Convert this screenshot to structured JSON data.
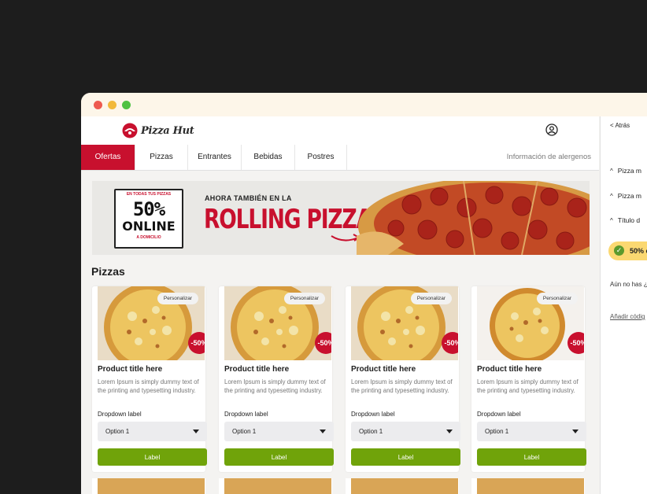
{
  "brand": {
    "name": "Pizza Hut",
    "accent": "#c8102e",
    "button_green": "#70a30a"
  },
  "header": {
    "account_icon": "user-circle-icon"
  },
  "nav": {
    "tabs": [
      "Ofertas",
      "Pizzas",
      "Entrantes",
      "Bebidas",
      "Postres"
    ],
    "active_tab": "Ofertas",
    "allergens_link": "Información de alergenos"
  },
  "banner": {
    "badge_top": "EN TODAS TUS PIZZAS",
    "badge_percent": "50%",
    "badge_online": "ONLINE",
    "badge_sub": "A DOMICILIO",
    "kicker": "AHORA TAMBIÉN EN LA",
    "title": "ROLLING PIZZA"
  },
  "section": {
    "title": "Pizzas"
  },
  "products": [
    {
      "personalize": "Personalizar",
      "discount": "-50%",
      "title": "Product title here",
      "description": "Lorem Ipsum is simply dummy text of the printing and typesetting industry.",
      "dropdown_label": "Dropdown label",
      "dropdown_value": "Option 1",
      "button": "Label"
    },
    {
      "personalize": "Personalizar",
      "discount": "-50%",
      "title": "Product title here",
      "description": "Lorem Ipsum is simply dummy text of the printing and typesetting industry.",
      "dropdown_label": "Dropdown label",
      "dropdown_value": "Option 1",
      "button": "Label"
    },
    {
      "personalize": "Personalizar",
      "discount": "-50%",
      "title": "Product title here",
      "description": "Lorem Ipsum is simply dummy text of the printing and typesetting industry.",
      "dropdown_label": "Dropdown label",
      "dropdown_value": "Option 1",
      "button": "Label"
    },
    {
      "personalize": "Personalizar",
      "discount": "-50%",
      "title": "Product title here",
      "description": "Lorem Ipsum is simply dummy text of the printing and typesetting industry.",
      "dropdown_label": "Dropdown label",
      "dropdown_value": "Option 1",
      "button": "Label"
    }
  ],
  "panel": {
    "back": "< Atrás",
    "accordion": [
      "Pizza m",
      "Pizza m",
      "Título d"
    ],
    "promo": "50% c",
    "note": "Aún no has ¿quieres ver",
    "link": "Añadir códig"
  }
}
